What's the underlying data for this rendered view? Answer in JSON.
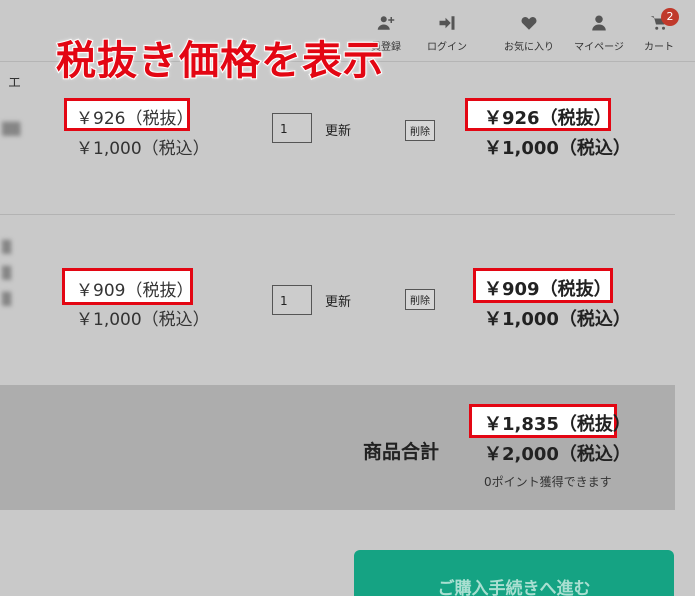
{
  "overlay_title": "税抜き価格を表示",
  "header": {
    "nav": [
      {
        "label": "員登録",
        "icon": "user-plus-icon"
      },
      {
        "label": "ログイン",
        "icon": "sign-in-icon"
      },
      {
        "label": "お気に入り",
        "icon": "heart-icon"
      },
      {
        "label": "マイページ",
        "icon": "user-icon"
      },
      {
        "label": "カート",
        "icon": "cart-icon"
      }
    ],
    "cart_count": "2"
  },
  "column_label": "エ",
  "items": [
    {
      "unit_price_excl": "￥926（税抜）",
      "unit_price_incl": "￥1,000（税込）",
      "quantity": "1",
      "update_label": "更新",
      "delete_label": "削除",
      "subtotal_excl": "￥926（税抜）",
      "subtotal_incl": "￥1,000（税込）"
    },
    {
      "unit_price_excl": "￥909（税抜）",
      "unit_price_incl": "￥1,000（税込）",
      "quantity": "1",
      "update_label": "更新",
      "delete_label": "削除",
      "subtotal_excl": "￥909（税抜）",
      "subtotal_incl": "￥1,000（税込）"
    }
  ],
  "totals": {
    "label": "商品合計",
    "total_excl": "￥1,835（税抜）",
    "total_incl": "￥2,000（税込）",
    "points_note": "0ポイント獲得できます"
  },
  "checkout_label": "ご購入手続きへ進む",
  "colors": {
    "highlight": "#e30613",
    "checkout": "#15a383",
    "badge": "#c0392b"
  }
}
